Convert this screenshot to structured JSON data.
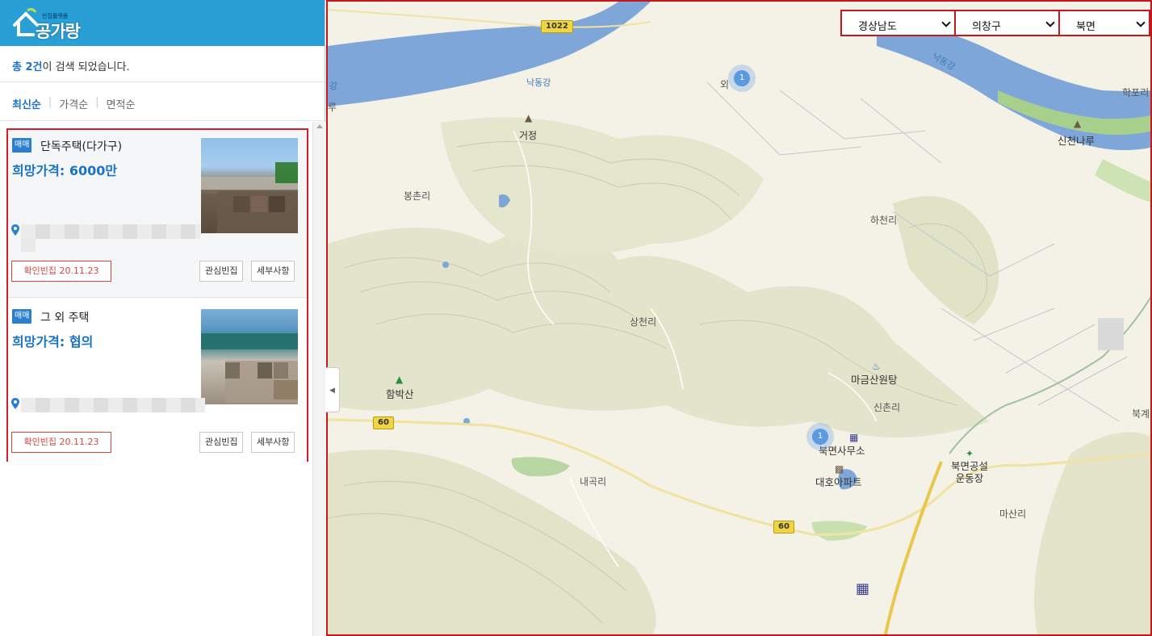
{
  "sidebar": {
    "logo": {
      "name": "공가랑",
      "tagline": "빈집플랫폼"
    },
    "result": {
      "prefix": "총 ",
      "count": "2건",
      "suffix": "이 검색 되었습니다."
    },
    "sort_tabs": [
      {
        "label": "최신순",
        "active": true
      },
      {
        "label": "가격순",
        "active": false
      },
      {
        "label": "면적순",
        "active": false
      }
    ],
    "listings": [
      {
        "type_badge": "매매",
        "title": "단독주택(다가구)",
        "price": "희망가격: 6000만",
        "confirm_tag": "확인빈집 20.11.23",
        "fav_button": "관심빈집",
        "detail_button": "세부사항"
      },
      {
        "type_badge": "매매",
        "title": "그 외 주택",
        "price": "희망가격: 협의",
        "confirm_tag": "확인빈집 20.11.23",
        "fav_button": "관심빈집",
        "detail_button": "세부사항"
      }
    ]
  },
  "region": {
    "province": "경상남도",
    "district": "의창구",
    "town": "북면"
  },
  "map": {
    "labels": {
      "nakdong_left": "낙동강",
      "nakdong_right": "낙동강",
      "nakdong_edge": "강",
      "geojeong": "거정",
      "bongchon": "봉촌리",
      "oe": "외",
      "hakpo": "학포리",
      "sincheon_naru": "신천나루",
      "hacheon": "하천리",
      "sangcheon": "상천리",
      "hambaksan": "함박산",
      "magumsan": "마금산원탕",
      "sinchon": "신촌리",
      "bukmyeon_office": "북면사무소",
      "daeho_apt": "대호아파트",
      "bukmyeon_field": "북면공설\n운동장",
      "naegok": "내곡리",
      "masan": "마산리",
      "bukgye": "북계",
      "left_edge": "루"
    },
    "road_shields": [
      "1022",
      "60",
      "60"
    ],
    "clusters": [
      "1",
      "1"
    ],
    "colors": {
      "river": "#7ea6d8",
      "land": "#f4f1e6",
      "forest": "#dfe3c9",
      "contour": "#c9c5a8",
      "green": "#a8d08d"
    }
  }
}
